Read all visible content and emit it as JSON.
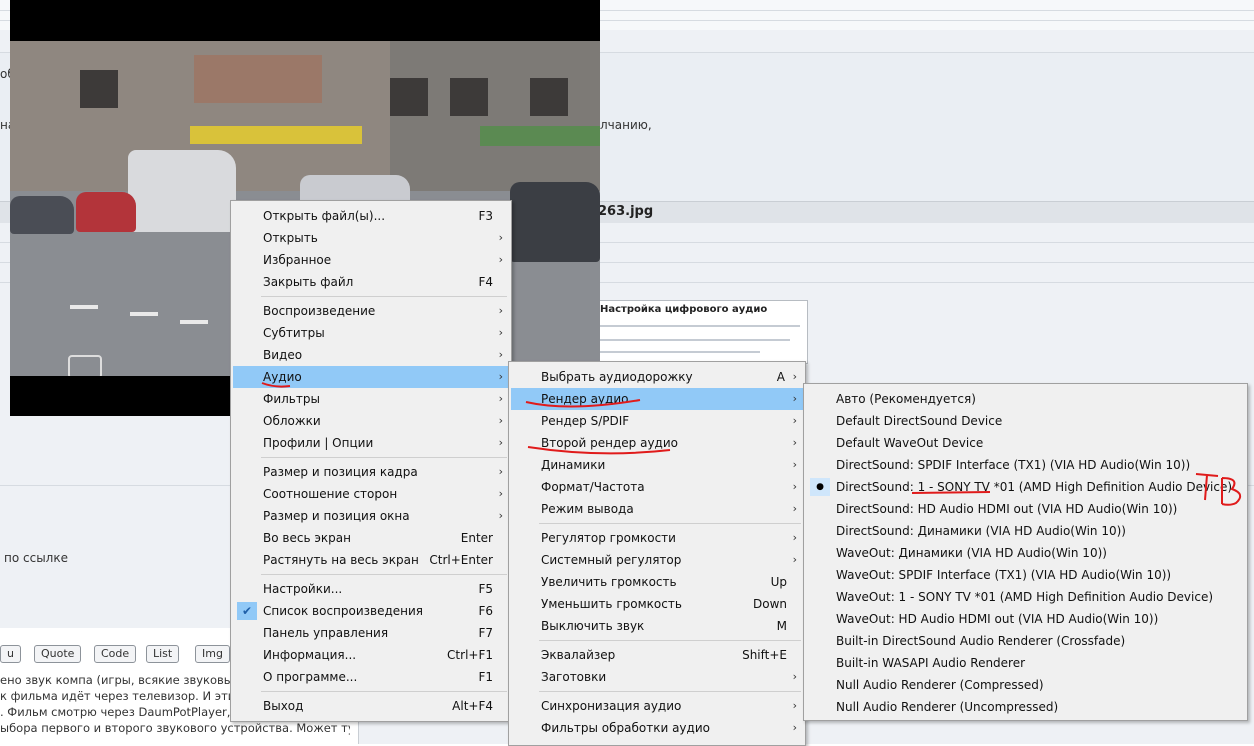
{
  "forum": {
    "text_left_1": "об",
    "text_left_2": "на",
    "text_right_1": "лчанию,",
    "file_name": "263.jpg",
    "link_text": "по ссылке",
    "thumb_title": "Настройка цифрового аудио",
    "editor_buttons": [
      "u",
      "Quote",
      "Code",
      "List",
      "Img"
    ],
    "editor_lines": [
      "ено звук компа (игры, всякие звуковы",
      "к фильма идёт через телевизор. И эти",
      ". Фильм смотрю через DaumPotPlayer, а",
      "ыбора первого и второго звукового устройства. Может тут"
    ]
  },
  "main_menu": {
    "items": [
      {
        "label": "Открыть файл(ы)...",
        "shortcut": "F3",
        "submenu": false
      },
      {
        "label": "Открыть",
        "shortcut": "",
        "submenu": true
      },
      {
        "label": "Избранное",
        "shortcut": "",
        "submenu": true
      },
      {
        "label": "Закрыть файл",
        "shortcut": "F4",
        "submenu": false
      },
      {
        "label": "Воспроизведение",
        "shortcut": "",
        "submenu": true
      },
      {
        "label": "Субтитры",
        "shortcut": "",
        "submenu": true
      },
      {
        "label": "Видео",
        "shortcut": "",
        "submenu": true
      },
      {
        "label": "Аудио",
        "shortcut": "",
        "submenu": true
      },
      {
        "label": "Фильтры",
        "shortcut": "",
        "submenu": true
      },
      {
        "label": "Обложки",
        "shortcut": "",
        "submenu": true
      },
      {
        "label": "Профили | Опции",
        "shortcut": "",
        "submenu": true
      },
      {
        "label": "Размер и позиция кадра",
        "shortcut": "",
        "submenu": true
      },
      {
        "label": "Соотношение сторон",
        "shortcut": "",
        "submenu": true
      },
      {
        "label": "Размер и позиция окна",
        "shortcut": "",
        "submenu": true
      },
      {
        "label": "Во весь экран",
        "shortcut": "Enter",
        "submenu": false
      },
      {
        "label": "Растянуть на весь экран",
        "shortcut": "Ctrl+Enter",
        "submenu": false
      },
      {
        "label": "Настройки...",
        "shortcut": "F5",
        "submenu": false
      },
      {
        "label": "Список воспроизведения",
        "shortcut": "F6",
        "submenu": false
      },
      {
        "label": "Панель управления",
        "shortcut": "F7",
        "submenu": false
      },
      {
        "label": "Информация...",
        "shortcut": "Ctrl+F1",
        "submenu": false
      },
      {
        "label": "О программе...",
        "shortcut": "F1",
        "submenu": false
      },
      {
        "label": "Выход",
        "shortcut": "Alt+F4",
        "submenu": false
      }
    ]
  },
  "audio_menu": {
    "items": [
      {
        "label": "Выбрать аудиодорожку",
        "shortcut": "A",
        "submenu": true
      },
      {
        "label": "Рендер аудио",
        "shortcut": "",
        "submenu": true
      },
      {
        "label": "Рендер S/PDIF",
        "shortcut": "",
        "submenu": true
      },
      {
        "label": "Второй рендер аудио",
        "shortcut": "",
        "submenu": true
      },
      {
        "label": "Динамики",
        "shortcut": "",
        "submenu": true
      },
      {
        "label": "Формат/Частота",
        "shortcut": "",
        "submenu": true
      },
      {
        "label": "Режим вывода",
        "shortcut": "",
        "submenu": true
      },
      {
        "label": "Регулятор громкости",
        "shortcut": "",
        "submenu": true
      },
      {
        "label": "Системный регулятор",
        "shortcut": "",
        "submenu": true
      },
      {
        "label": "Увеличить громкость",
        "shortcut": "Up",
        "submenu": false
      },
      {
        "label": "Уменьшить громкость",
        "shortcut": "Down",
        "submenu": false
      },
      {
        "label": "Выключить звук",
        "shortcut": "M",
        "submenu": false
      },
      {
        "label": "Эквалайзер",
        "shortcut": "Shift+E",
        "submenu": false
      },
      {
        "label": "Заготовки",
        "shortcut": "",
        "submenu": true
      },
      {
        "label": "Синхронизация аудио",
        "shortcut": "",
        "submenu": true
      },
      {
        "label": "Фильтры обработки аудио",
        "shortcut": "",
        "submenu": true
      }
    ]
  },
  "render_menu": {
    "items": [
      {
        "label": "Авто (Рекомендуется)"
      },
      {
        "label": "Default DirectSound Device"
      },
      {
        "label": "Default WaveOut Device"
      },
      {
        "label": "DirectSound: SPDIF Interface (TX1) (VIA HD Audio(Win 10))"
      },
      {
        "label": "DirectSound: 1 - SONY TV  *01 (AMD High Definition Audio Device)"
      },
      {
        "label": "DirectSound: HD Audio HDMI out (VIA HD Audio(Win 10))"
      },
      {
        "label": "DirectSound: Динамики (VIA HD Audio(Win 10))"
      },
      {
        "label": "WaveOut: Динамики (VIA HD Audio(Win 10))"
      },
      {
        "label": "WaveOut: SPDIF Interface (TX1) (VIA HD Audio(Win 10))"
      },
      {
        "label": "WaveOut: 1 - SONY TV  *01 (AMD High Definition Audio Device)"
      },
      {
        "label": "WaveOut: HD Audio HDMI out (VIA HD Audio(Win 10))"
      },
      {
        "label": "Built-in DirectSound Audio Renderer (Crossfade)"
      },
      {
        "label": "Built-in WASAPI Audio Renderer"
      },
      {
        "label": "Null Audio Renderer (Compressed)"
      },
      {
        "label": "Null Audio Renderer (Uncompressed)"
      }
    ],
    "selected_index": 4
  },
  "annotation": {
    "handwritten_text": "ТВ",
    "color": "#e01b1b"
  },
  "glyphs": {
    "submenu_arrow": "›",
    "check": "✔",
    "bullet": "●"
  },
  "colors": {
    "menu_bg": "#f0f0f0",
    "highlight": "#91c9f7"
  }
}
